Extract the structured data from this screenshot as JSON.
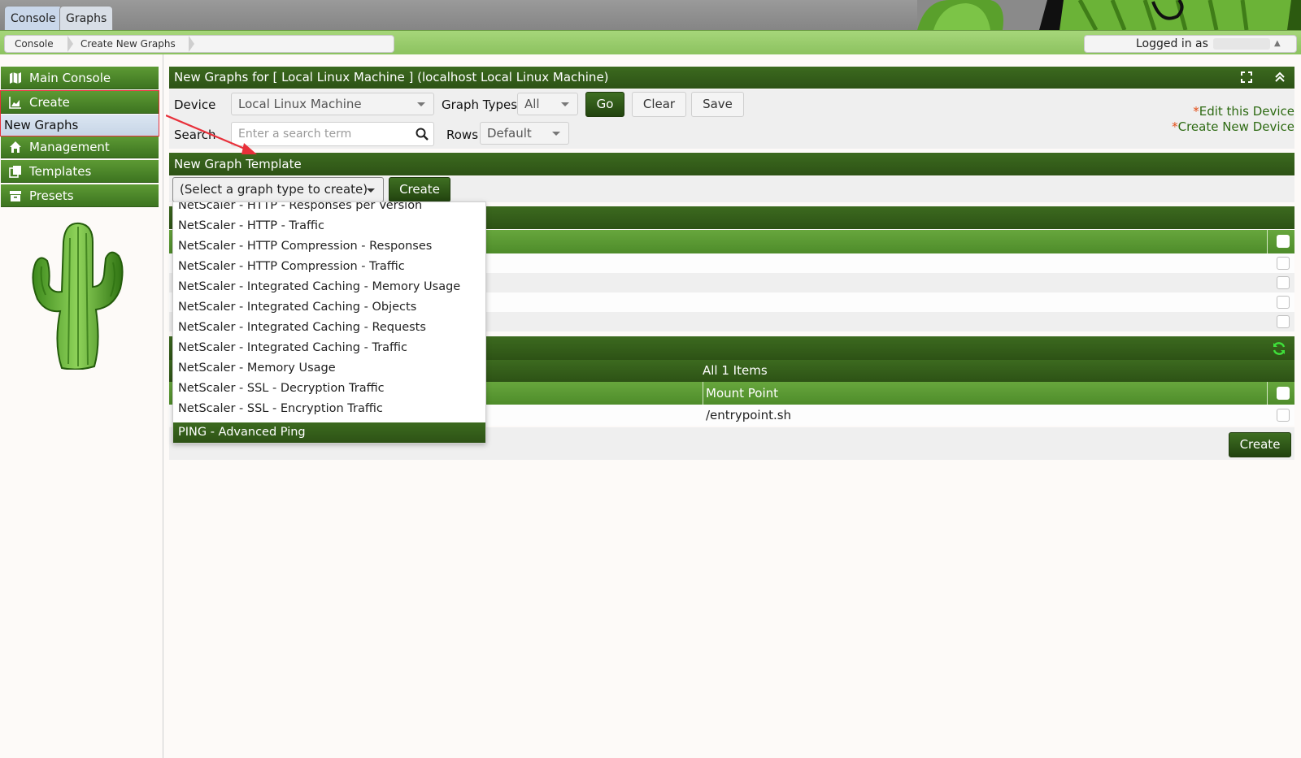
{
  "tabs": [
    {
      "label": "Console",
      "active": true
    },
    {
      "label": "Graphs",
      "active": false
    }
  ],
  "breadcrumbs": [
    "Console",
    "Create New Graphs"
  ],
  "login": {
    "label": "Logged in as"
  },
  "sidebar": {
    "items": [
      {
        "label": "Main Console",
        "icon": "map-icon"
      },
      {
        "label": "Create",
        "icon": "area-chart-icon"
      },
      {
        "label": "New Graphs",
        "icon": ""
      },
      {
        "label": "Management",
        "icon": "home-icon"
      },
      {
        "label": "Templates",
        "icon": "copy-icon"
      },
      {
        "label": "Presets",
        "icon": "archive-icon"
      }
    ]
  },
  "header": {
    "title": "New Graphs for [ Local Linux Machine ] (localhost Local Linux Machine)"
  },
  "filters": {
    "device_label": "Device",
    "device_value": "Local Linux Machine",
    "graph_types_label": "Graph Types",
    "graph_types_value": "All",
    "go": "Go",
    "clear": "Clear",
    "save": "Save",
    "search_label": "Search",
    "search_placeholder": "Enter a search term",
    "rows_label": "Rows",
    "rows_value": "Default"
  },
  "links": {
    "edit_device": "Edit this Device",
    "create_device": "Create New Device",
    "star": "*"
  },
  "template": {
    "title": "New Graph Template",
    "select_value": "(Select a graph type to create)",
    "create": "Create"
  },
  "dropdown": {
    "options": [
      "NetScaler - HTTP - Responses per Version",
      "NetScaler - HTTP - Traffic",
      "NetScaler - HTTP Compression - Responses",
      "NetScaler - HTTP Compression - Traffic",
      "NetScaler - Integrated Caching - Memory Usage",
      "NetScaler - Integrated Caching - Objects",
      "NetScaler - Integrated Caching - Requests",
      "NetScaler - Integrated Caching - Traffic",
      "NetScaler - Memory Usage",
      "NetScaler - SSL - Decryption Traffic",
      "NetScaler - SSL - Encryption Traffic"
    ],
    "selected": "PING - Advanced Ping"
  },
  "data_query": {
    "items_label": "All 1 Items",
    "column_mount": "Mount Point",
    "row_mount": "/entrypoint.sh"
  },
  "footer": {
    "create": "Create"
  },
  "colors": {
    "dark_green": "#2d5215",
    "light_green": "#8cc25f",
    "link_green": "#2d6a12",
    "star_orange": "#e24b14",
    "annotation_red": "#e8303a"
  }
}
